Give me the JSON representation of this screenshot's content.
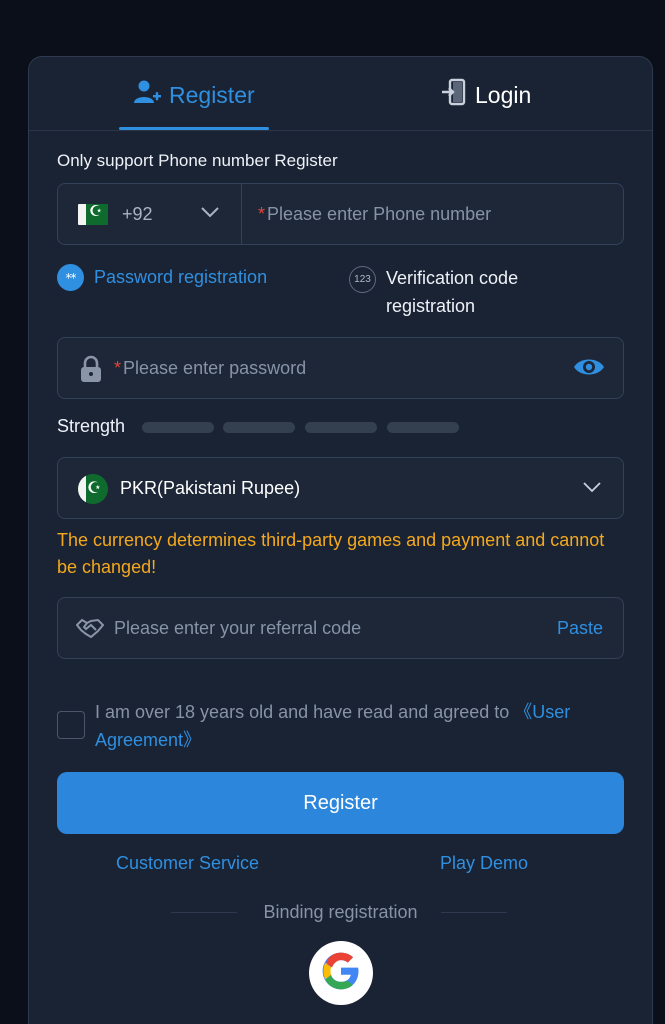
{
  "tabs": {
    "register_label": "Register",
    "login_label": "Login"
  },
  "form": {
    "heading": "Only support Phone number Register",
    "country_code": "+92",
    "phone_placeholder": "Please enter Phone number",
    "required_mark": "*",
    "mode_password": "Password registration",
    "mode_password_icon": "**",
    "mode_code": "Verification code registration",
    "mode_code_icon": "123",
    "password_placeholder": "Please enter password",
    "strength_label": "Strength",
    "currency": "PKR(Pakistani Rupee)",
    "currency_warning": "The currency determines third-party games and payment and cannot be changed!",
    "referral_placeholder": "Please enter your referral code",
    "paste_label": "Paste",
    "agreement_text": "I am over 18 years old and have read and agreed to ",
    "agreement_link": "《User Agreement》",
    "register_button": "Register"
  },
  "footer": {
    "customer_service": "Customer Service",
    "play_demo": "Play Demo",
    "binding_registration": "Binding registration"
  },
  "colors": {
    "accent": "#2f8fe0",
    "warning": "#f4a81d",
    "background": "#1a2333"
  }
}
